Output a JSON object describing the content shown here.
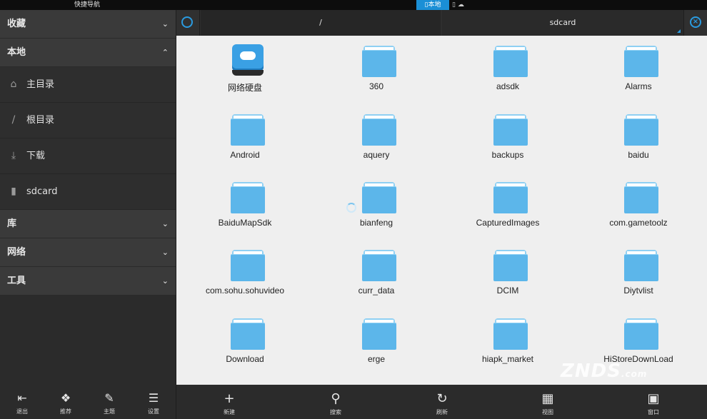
{
  "topbar": {
    "title": "快捷导航",
    "tab_local": "▯本地",
    "tab_other": "▯ ☁"
  },
  "sidebar": {
    "sections_top": [
      {
        "label": "收藏",
        "chev": "⌄"
      },
      {
        "label": "本地",
        "chev": "⌃"
      }
    ],
    "items": [
      {
        "label": "主目录",
        "icon": "⌂"
      },
      {
        "label": "根目录",
        "icon": "/"
      },
      {
        "label": "下载",
        "icon": "⤓"
      },
      {
        "label": "sdcard",
        "icon": "▮"
      }
    ],
    "sections_bottom": [
      {
        "label": "库",
        "chev": "⌄"
      },
      {
        "label": "网络",
        "chev": "⌄"
      },
      {
        "label": "工具",
        "chev": "⌄"
      }
    ],
    "bottom_buttons": [
      {
        "label": "退出",
        "icon": "⇤"
      },
      {
        "label": "推荐",
        "icon": "❖"
      },
      {
        "label": "主题",
        "icon": "✎"
      },
      {
        "label": "设置",
        "icon": "☰"
      }
    ]
  },
  "pathbar": {
    "root": "/",
    "current": "sdcard"
  },
  "files": [
    "网络硬盘",
    "360",
    "adsdk",
    "Alarms",
    "Android",
    "aquery",
    "backups",
    "baidu",
    "BaiduMapSdk",
    "bianfeng",
    "CapturedImages",
    "com.gametoolz",
    "com.sohu.sohuvideo",
    "curr_data",
    "DCIM",
    "Diytvlist",
    "Download",
    "erge",
    "hiapk_market",
    "HiStoreDownLoad"
  ],
  "bottom_toolbar": [
    {
      "label": "新建",
      "icon": "+"
    },
    {
      "label": "搜索",
      "icon": "⚲"
    },
    {
      "label": "刷新",
      "icon": "↻"
    },
    {
      "label": "视图",
      "icon": "▦"
    },
    {
      "label": "窗口",
      "icon": "▣"
    }
  ],
  "watermark": {
    "main": "ZNDS",
    "suffix": ".com"
  },
  "colors": {
    "accent": "#2a9be0",
    "folder": "#5cb6ea",
    "grid_bg": "#efefef"
  }
}
